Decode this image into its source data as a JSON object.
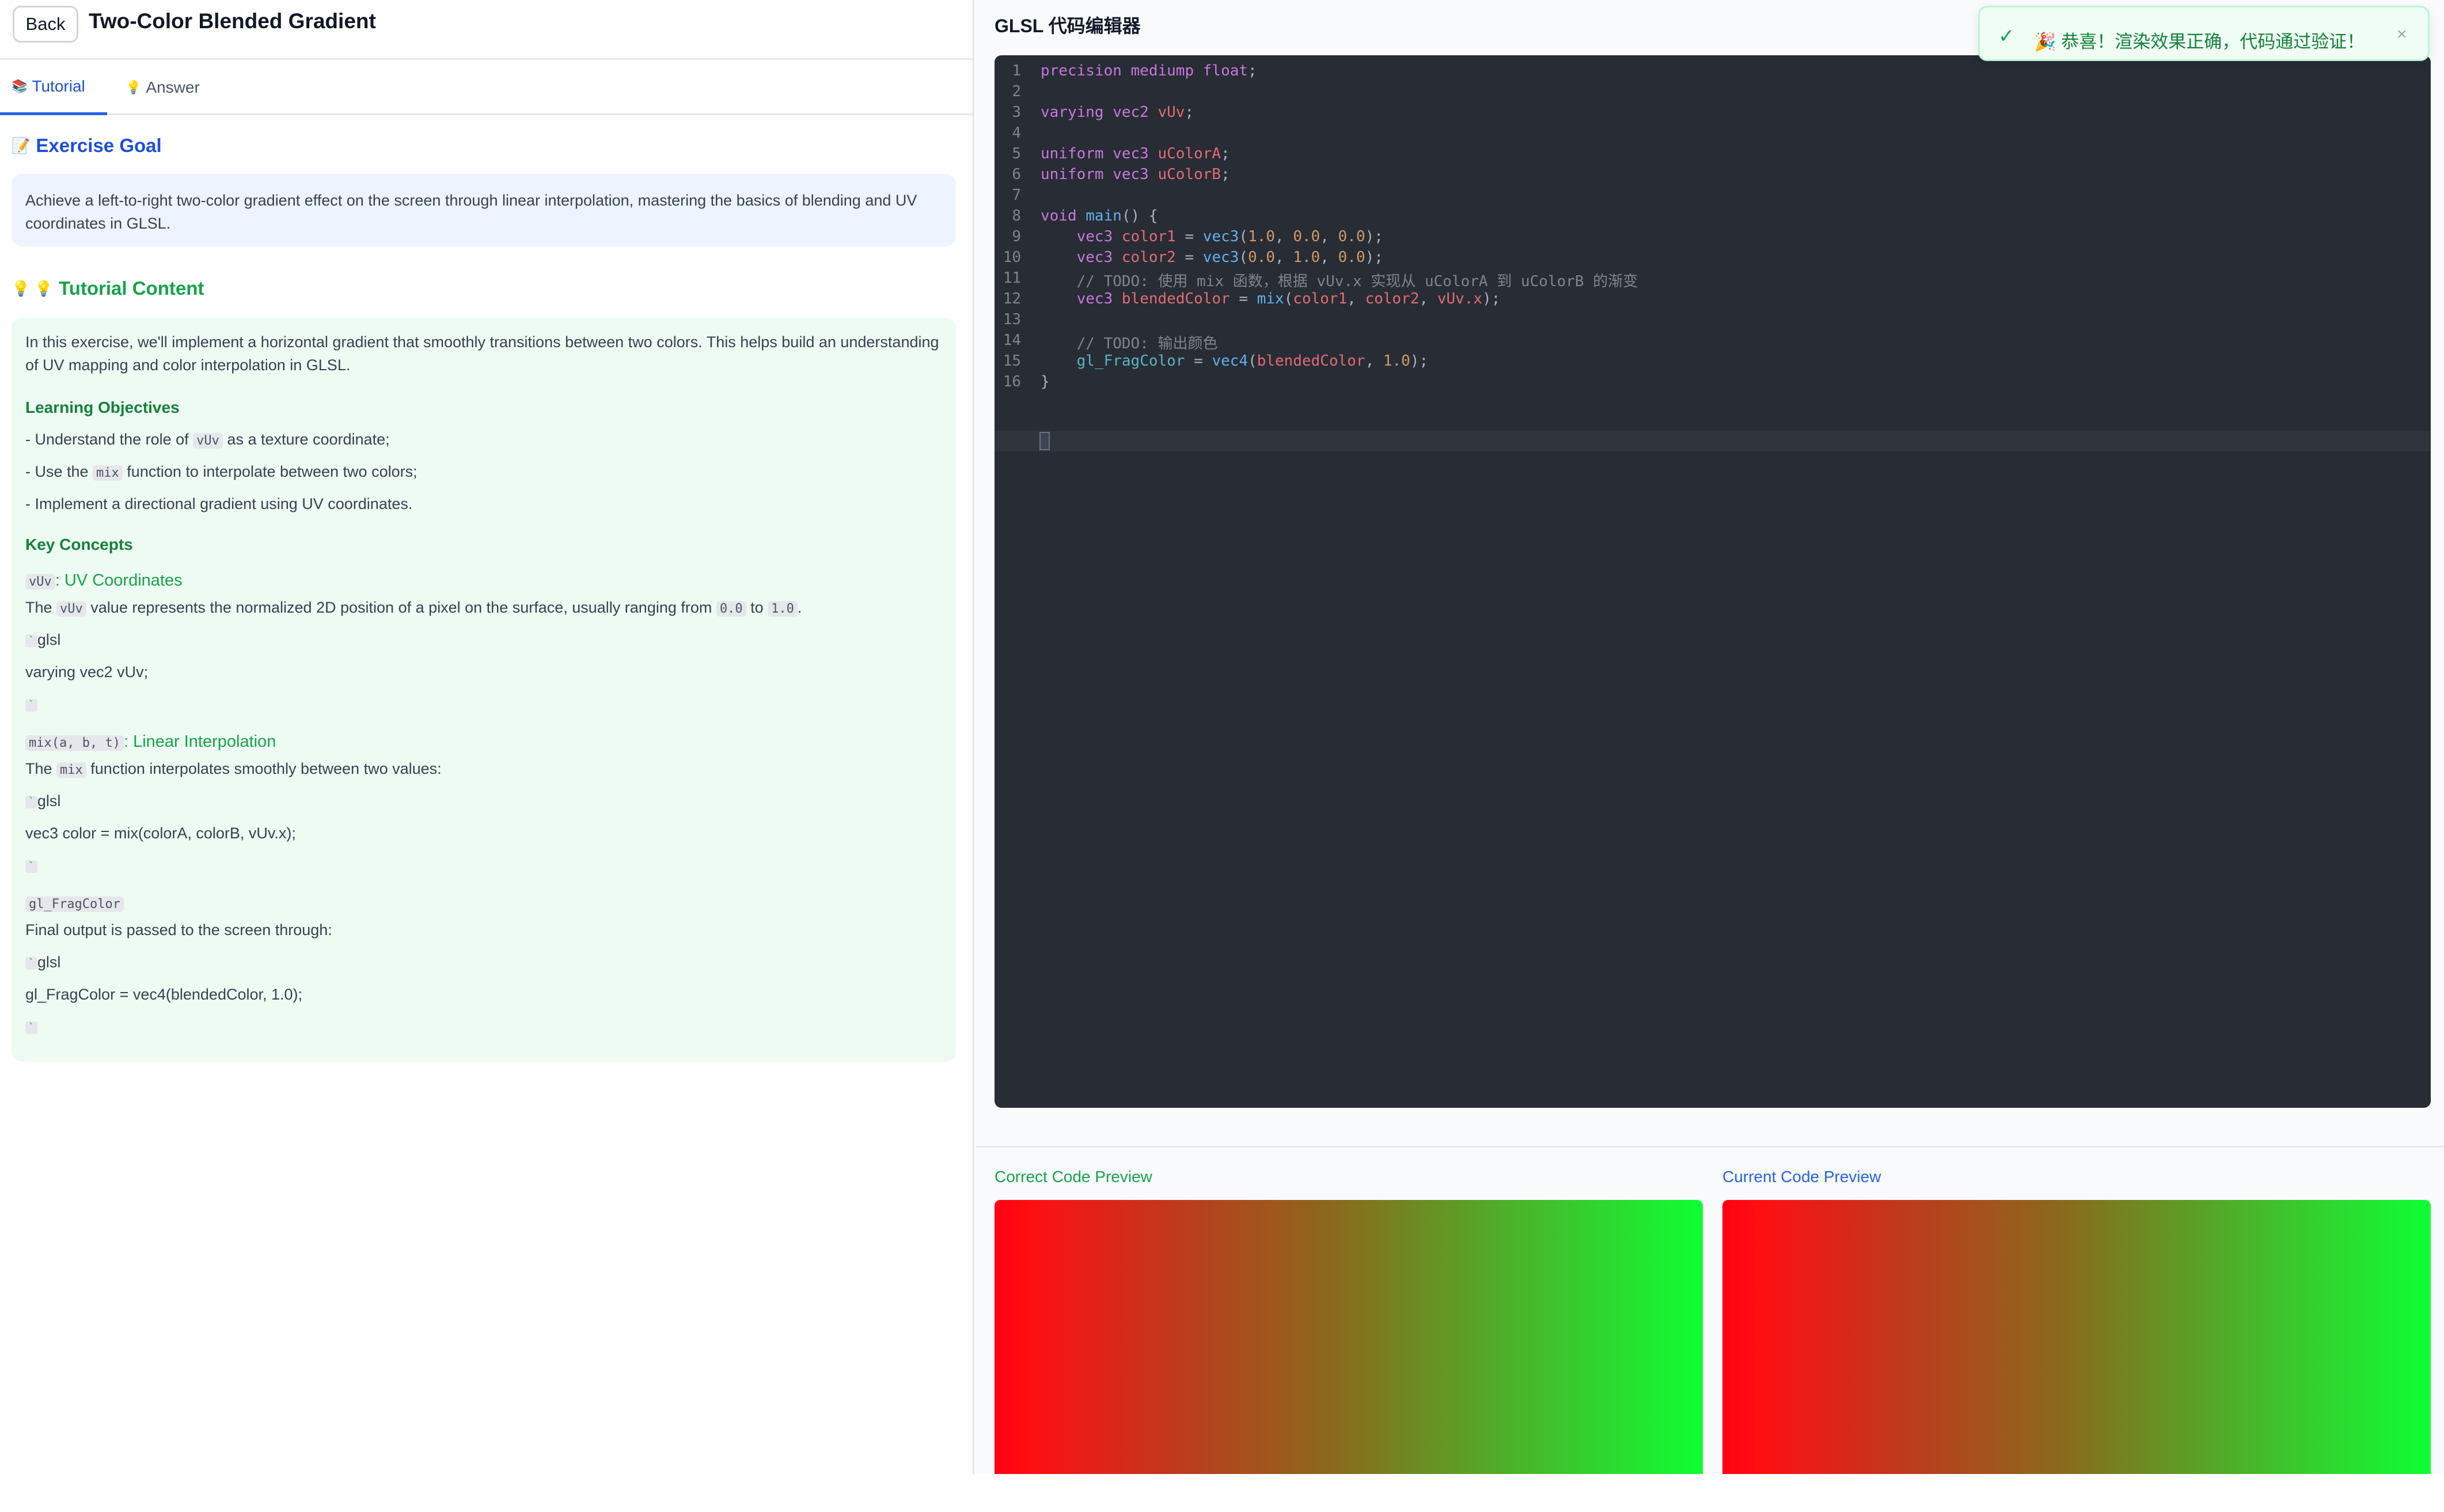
{
  "header": {
    "back_label": "Back",
    "title": "Two-Color Blended Gradient"
  },
  "tabs": [
    {
      "icon": "📚",
      "label": "Tutorial",
      "active": true
    },
    {
      "icon": "💡",
      "label": "Answer",
      "active": false
    }
  ],
  "goal": {
    "icon": "📝",
    "title": "Exercise Goal",
    "text": "Achieve a left-to-right two-color gradient effect on the screen through linear interpolation, mastering the basics of blending and UV coordinates in GLSL."
  },
  "tutorial": {
    "icons": "💡 💡",
    "title": "Tutorial Content",
    "intro": "In this exercise, we'll implement a horizontal gradient that smoothly transitions between two colors. This helps build an understanding of UV mapping and color interpolation in GLSL.",
    "objectives_heading": "Learning Objectives",
    "obj1_a": "- Understand the role of ",
    "obj1_code": "vUv",
    "obj1_b": " as a texture coordinate;",
    "obj2_a": "- Use the ",
    "obj2_code": "mix",
    "obj2_b": " function to interpolate between two colors;",
    "obj3": "- Implement a directional gradient using UV coordinates.",
    "concepts_heading": "Key Concepts",
    "c1_code": "vUv",
    "c1_title": ": UV Coordinates",
    "c1_a": "The ",
    "c1_code2": "vUv",
    "c1_b": " value represents the normalized 2D position of a pixel on the surface, usually ranging from ",
    "c1_code3": "0.0",
    "c1_c": " to ",
    "c1_code4": "1.0",
    "c1_d": ".",
    "tick": "`",
    "lang": "glsl",
    "c1_example": "varying vec2 vUv;",
    "c2_code": "mix(a, b, t)",
    "c2_title": ": Linear Interpolation",
    "c2_a": "The ",
    "c2_code2": "mix",
    "c2_b": " function interpolates smoothly between two values:",
    "c2_example": "vec3 color = mix(colorA, colorB, vUv.x);",
    "c3_code": "gl_FragColor",
    "c3_text": "Final output is passed to the screen through:",
    "c3_example": "gl_FragColor = vec4(blendedColor, 1.0);"
  },
  "editor": {
    "title": "GLSL 代码编辑器",
    "line_numbers": [
      "1",
      "2",
      "3",
      "4",
      "5",
      "6",
      "7",
      "8",
      "9",
      "10",
      "11",
      "12",
      "13",
      "14",
      "15",
      "16"
    ],
    "code": {
      "l1_kw": "precision mediump float",
      "semi": ";",
      "l3_kw": "varying vec2",
      "l3_var": "vUv",
      "l5_kw": "uniform vec3",
      "l5_var": "uColorA",
      "l6_var": "uColorB",
      "l8_kw": "void",
      "l8_fn": "main",
      "l8_rest": "() {",
      "l9_type": "vec3",
      "l9_var": "color1",
      "eq": " = ",
      "vec3_fn": "vec3",
      "open": "(",
      "close": ")",
      "l9_n1": "1.0",
      "l9_n2": "0.0",
      "l9_n3": "0.0",
      "comma": ", ",
      "l10_var": "color2",
      "l10_n1": "0.0",
      "l10_n2": "1.0",
      "l10_n3": "0.0",
      "l11_comment": "// TODO: 使用 mix 函数，根据 vUv.x 实现从 uColorA 到 uColorB 的渐变",
      "l12_var": "blendedColor",
      "mix_fn": "mix",
      "l12_arg3": "vUv.x",
      "l14_comment": "// TODO: 输出颜色",
      "l15_out": "gl_FragColor",
      "vec4_fn": "vec4",
      "l15_n": "1.0",
      "l16": "}"
    }
  },
  "previews": {
    "correct_label": "Correct Code Preview",
    "current_label": "Current Code Preview",
    "gradient_from": "#ff0011",
    "gradient_to": "#0eff33"
  },
  "toast": {
    "check": "✓",
    "message": "🎉 恭喜！渲染效果正确，代码通过验证！",
    "close": "×"
  }
}
